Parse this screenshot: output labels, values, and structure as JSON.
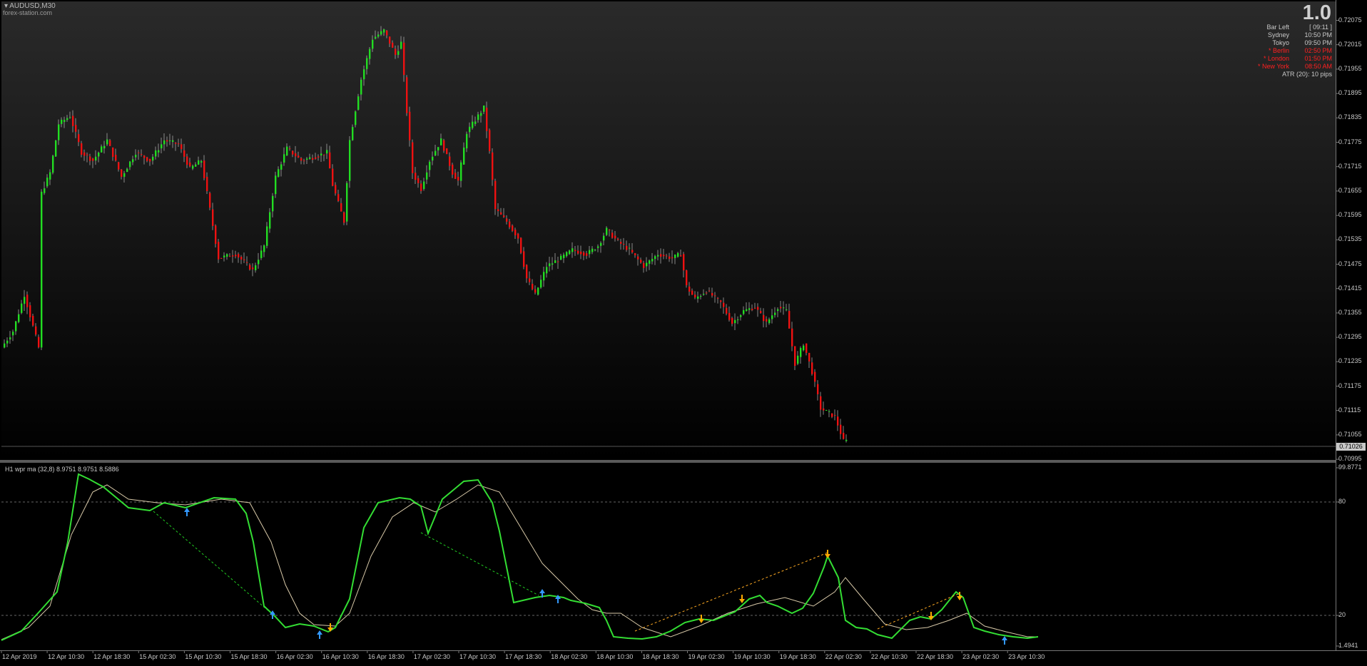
{
  "symbol": "AUDUSD,M30",
  "watermark": "forex-station.com",
  "big_value": "1.0",
  "info_panel": {
    "rows": [
      {
        "label": "Bar Left",
        "value": "[ 09:11 ]",
        "color": "#c8c8c8"
      },
      {
        "label": "Sydney",
        "value": "10:50 PM",
        "color": "#c8c8c8"
      },
      {
        "label": "Tokyo",
        "value": "09:50 PM",
        "color": "#c8c8c8"
      },
      {
        "label": "* Berlin",
        "value": "02:50 PM",
        "color": "#ff2020"
      },
      {
        "label": "* London",
        "value": "01:50 PM",
        "color": "#ff2020"
      },
      {
        "label": "* New York",
        "value": "08:50 AM",
        "color": "#ff2020"
      }
    ],
    "atr": "ATR (20): 10 pips"
  },
  "price_axis": {
    "labels": [
      "0.72075",
      "0.72015",
      "0.71955",
      "0.71895",
      "0.71835",
      "0.71775",
      "0.71715",
      "0.71655",
      "0.71595",
      "0.71535",
      "0.71475",
      "0.71415",
      "0.71355",
      "0.71295",
      "0.71235",
      "0.71175",
      "0.71115",
      "0.71055",
      "0.70995"
    ],
    "current_price": "0.71026"
  },
  "indicator": {
    "label": "H1 wpr ma (32,8) 8.9751 8.9751 8.5886",
    "scale_labels": [
      "99.8771",
      "80",
      "20",
      "1.4941"
    ]
  },
  "time_axis": {
    "labels": [
      "12 Apr 2019",
      "12 Apr 10:30",
      "12 Apr 18:30",
      "15 Apr 02:30",
      "15 Apr 10:30",
      "15 Apr 18:30",
      "16 Apr 02:30",
      "16 Apr 10:30",
      "16 Apr 18:30",
      "17 Apr 02:30",
      "17 Apr 10:30",
      "17 Apr 18:30",
      "18 Apr 02:30",
      "18 Apr 10:30",
      "18 Apr 18:30",
      "19 Apr 02:30",
      "19 Apr 10:30",
      "19 Apr 18:30",
      "22 Apr 02:30",
      "22 Apr 10:30",
      "22 Apr 18:30",
      "23 Apr 02:30",
      "23 Apr 10:30"
    ]
  },
  "colors": {
    "bull": "#22dd22",
    "bear": "#ee1111",
    "wpr_up": "#33dd33",
    "wpr_down": "#ffaa22",
    "signal": "#d8c9a8",
    "arrow_up": "#3399ff",
    "arrow_down": "#ffaa00"
  }
}
